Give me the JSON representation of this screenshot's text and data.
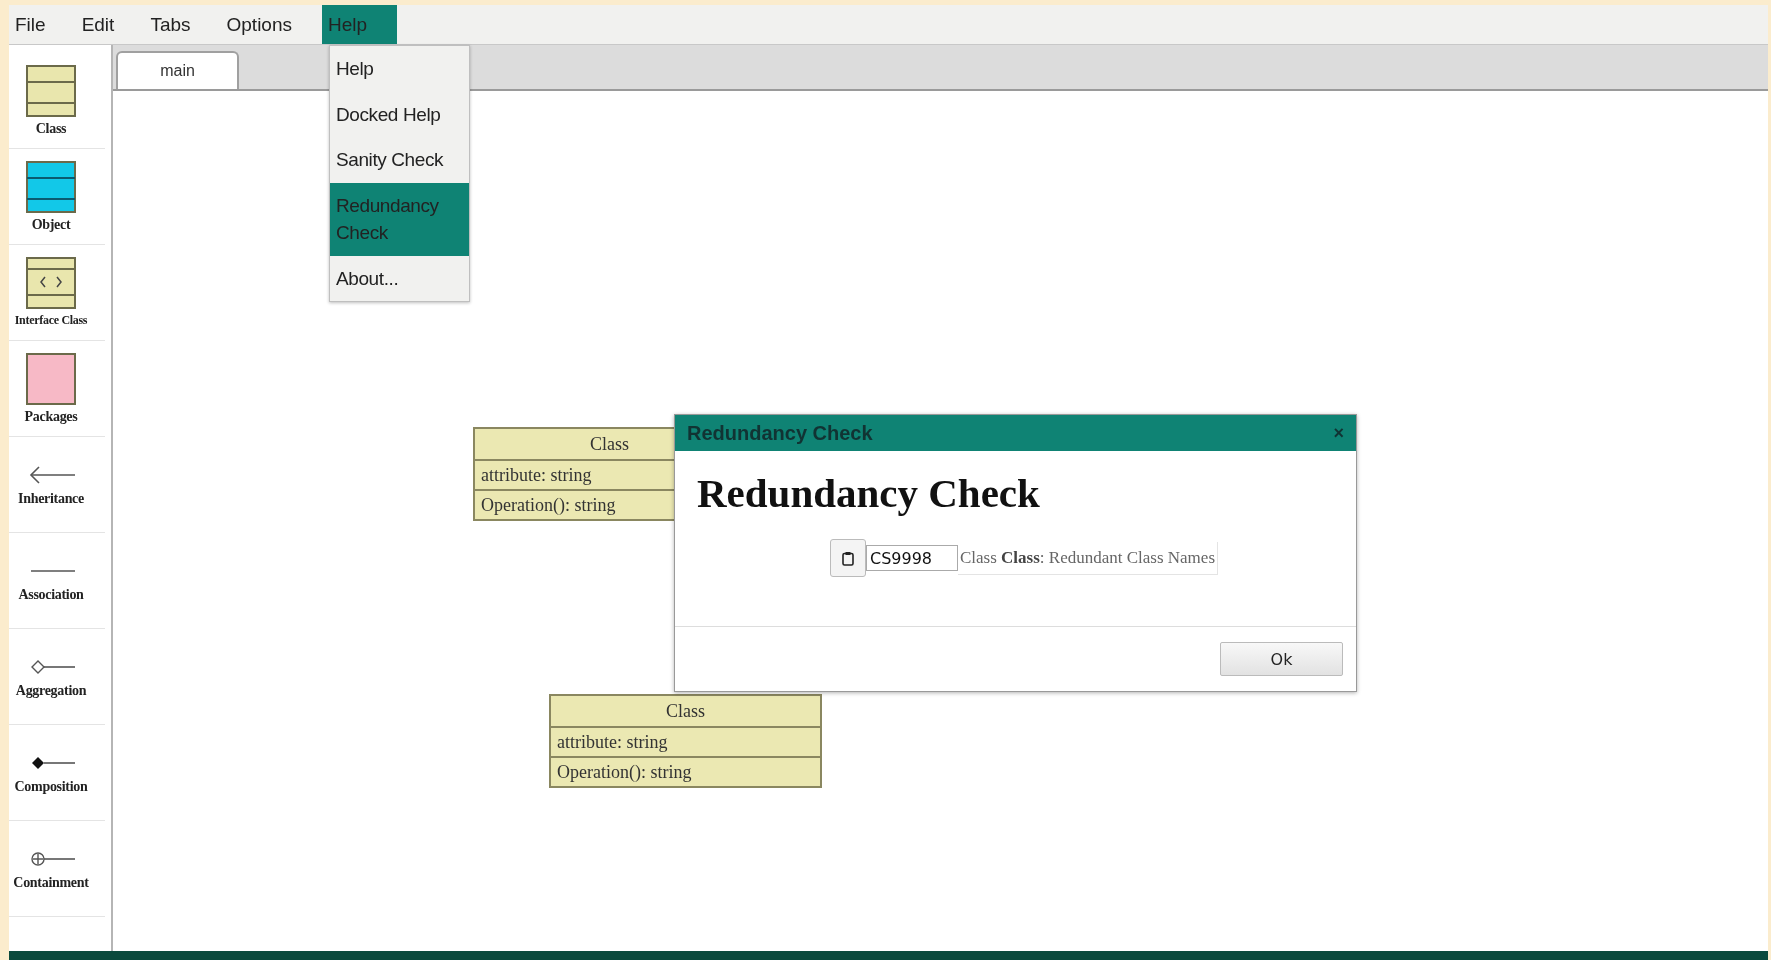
{
  "menu_bar": [
    {
      "label": "File",
      "selected": false
    },
    {
      "label": "Edit",
      "selected": false
    },
    {
      "label": "Tabs",
      "selected": false
    },
    {
      "label": "Options",
      "selected": false
    },
    {
      "label": "Help",
      "selected": true
    }
  ],
  "help_menu": [
    {
      "label": "Help",
      "selected": false
    },
    {
      "label": "Docked Help",
      "selected": false
    },
    {
      "label": "Sanity Check",
      "selected": false
    },
    {
      "label": "Redundancy Check",
      "selected": true
    },
    {
      "label": "About...",
      "selected": false
    }
  ],
  "tabs": [
    {
      "label": "main",
      "selected": true
    }
  ],
  "palette": [
    {
      "label": "Class",
      "kind": "class"
    },
    {
      "label": "Object",
      "kind": "object"
    },
    {
      "label": "Interface Class",
      "kind": "interface"
    },
    {
      "label": "Packages",
      "kind": "package"
    },
    {
      "label": "Inheritance",
      "kind": "inheritance"
    },
    {
      "label": "Association",
      "kind": "association"
    },
    {
      "label": "Aggregation",
      "kind": "aggregation"
    },
    {
      "label": "Composition",
      "kind": "composition"
    },
    {
      "label": "Containment",
      "kind": "containment"
    }
  ],
  "canvas_classes": [
    {
      "name": "Class",
      "attribute": "attribute: string",
      "operation": "Operation(): string"
    },
    {
      "name": "Class",
      "attribute": "attribute: string",
      "operation": "Operation(): string"
    }
  ],
  "dialog": {
    "title": "Redundancy Check",
    "close": "×",
    "heading": "Redundancy Check",
    "results": [
      {
        "code": "CS9998",
        "message": "Class **Class**: Redundant Class Names"
      }
    ],
    "ok_button": "Ok"
  }
}
